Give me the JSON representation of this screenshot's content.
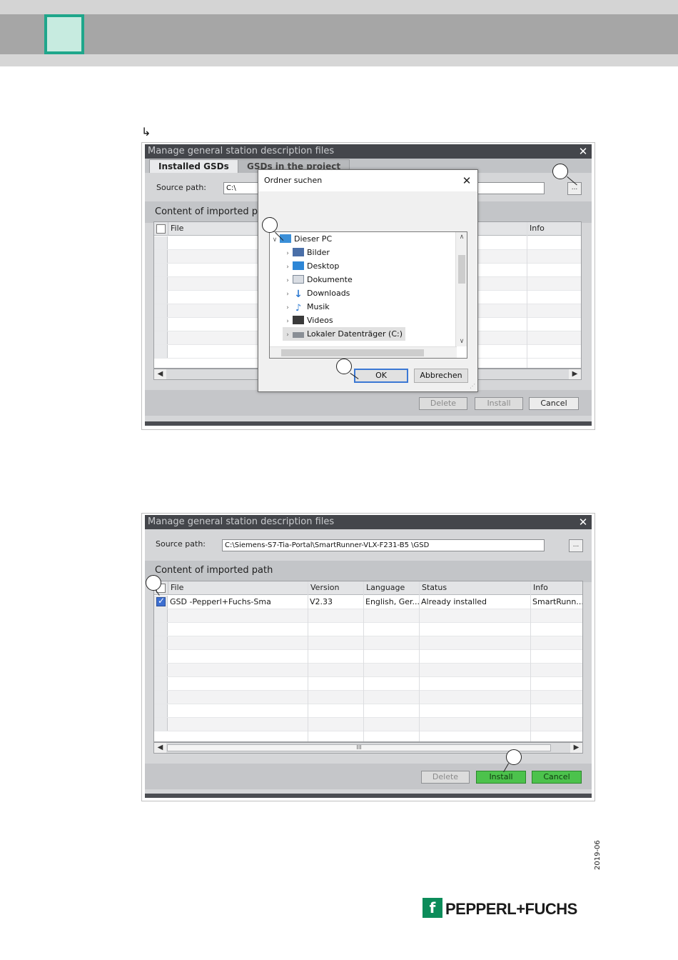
{
  "page": {
    "arrow_glyph": "↳",
    "date_code": "2019-06",
    "brand": "PEPPERL+FUCHS",
    "brand_mark": "f"
  },
  "dialog1": {
    "title": "Manage general station description files",
    "close": "✕",
    "tabs": [
      "Installed GSDs",
      "GSDs in the project"
    ],
    "source_label": "Source path:",
    "source_value": "C:\\",
    "browse_label": "...",
    "section_title": "Content of imported pa",
    "columns": [
      "File",
      "Info"
    ],
    "buttons": {
      "delete": "Delete",
      "install": "Install",
      "cancel": "Cancel"
    }
  },
  "folder_dialog": {
    "title": "Ordner suchen",
    "close": "✕",
    "root": "Dieser PC",
    "items": [
      "Bilder",
      "Desktop",
      "Dokumente",
      "Downloads",
      "Musik",
      "Videos",
      "Lokaler Datenträger (C:)"
    ],
    "ok": "OK",
    "cancel": "Abbrechen"
  },
  "dialog2": {
    "title": "Manage general station description files",
    "close": "✕",
    "source_label": "Source path:",
    "source_value": "C:\\Siemens-S7-Tia-Portal\\SmartRunner-VLX-F231-B5   \\GSD",
    "browse_label": "...",
    "section_title": "Content of imported path",
    "columns": [
      "File",
      "Version",
      "Language",
      "Status",
      "Info"
    ],
    "row": {
      "file": "GSD              -Pepperl+Fuchs-Sma",
      "version": "V2.33",
      "language": "English, Ger...",
      "status": "Already installed",
      "info": "SmartRunn..."
    },
    "scroll_thumb": "III",
    "buttons": {
      "delete": "Delete",
      "install": "Install",
      "cancel": "Cancel"
    }
  }
}
